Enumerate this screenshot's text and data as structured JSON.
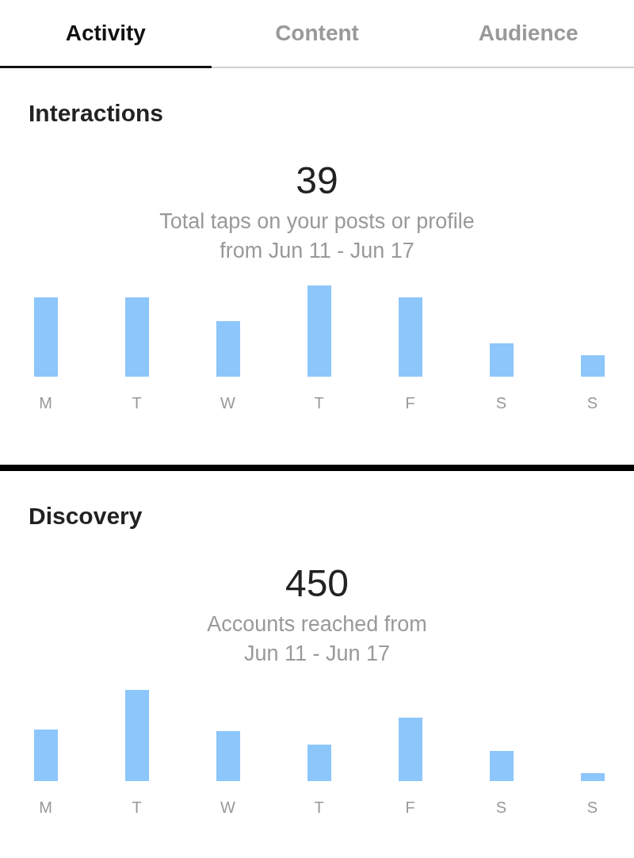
{
  "tabs": [
    {
      "label": "Activity",
      "selected": true
    },
    {
      "label": "Content",
      "selected": false
    },
    {
      "label": "Audience",
      "selected": false
    }
  ],
  "sections": [
    {
      "title": "Interactions",
      "value": "39",
      "caption_lines": [
        "Total taps on your posts or profile",
        "from Jun 11 - Jun 17"
      ],
      "days": [
        "M",
        "T",
        "W",
        "T",
        "F",
        "S",
        "S"
      ]
    },
    {
      "title": "Discovery",
      "value": "450",
      "caption_lines": [
        "Accounts reached from",
        "Jun 11 - Jun 17"
      ],
      "days": [
        "M",
        "T",
        "W",
        "T",
        "F",
        "S",
        "S"
      ]
    }
  ]
}
